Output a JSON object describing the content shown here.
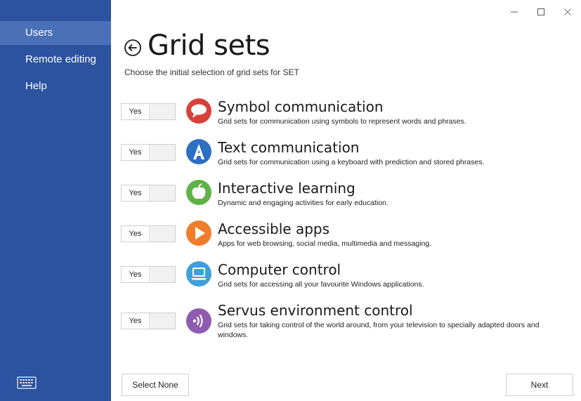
{
  "sidebar": {
    "items": [
      {
        "label": "Users",
        "active": true
      },
      {
        "label": "Remote editing",
        "active": false
      },
      {
        "label": "Help",
        "active": false
      }
    ],
    "keyboard_icon": "keyboard-icon",
    "color": "#2b53a0",
    "active_color": "#4a70b8"
  },
  "window": {
    "controls": [
      "minimize-icon",
      "maximize-icon",
      "close-icon"
    ]
  },
  "page": {
    "title": "Grid sets",
    "subtitle": "Choose the initial selection of grid sets for SET"
  },
  "gridsets": [
    {
      "toggle": "Yes",
      "title": "Symbol communication",
      "description": "Grid sets for communication using symbols to represent words and phrases.",
      "icon": "speech-bubble-icon",
      "color": "#d8413a"
    },
    {
      "toggle": "Yes",
      "title": "Text communication",
      "description": "Grid sets for communication using a keyboard with prediction and stored phrases.",
      "icon": "letter-a-icon",
      "color": "#2d6fc0"
    },
    {
      "toggle": "Yes",
      "title": "Interactive learning",
      "description": "Dynamic and engaging activities for early education.",
      "icon": "apple-icon",
      "color": "#5fb246"
    },
    {
      "toggle": "Yes",
      "title": "Accessible apps",
      "description": "Apps for web browsing, social media, multimedia and messaging.",
      "icon": "play-icon",
      "color": "#ef7d2c"
    },
    {
      "toggle": "Yes",
      "title": "Computer control",
      "description": "Grid sets for accessing all your favourite Windows applications.",
      "icon": "laptop-icon",
      "color": "#3ea0d8"
    },
    {
      "toggle": "Yes",
      "title": "Servus environment control",
      "description": "Grid sets for taking control of the world around, from your television to specially adapted doors and windows.",
      "icon": "signal-icon",
      "color": "#8e5bb0"
    }
  ],
  "footer": {
    "select_none": "Select None",
    "next": "Next"
  }
}
